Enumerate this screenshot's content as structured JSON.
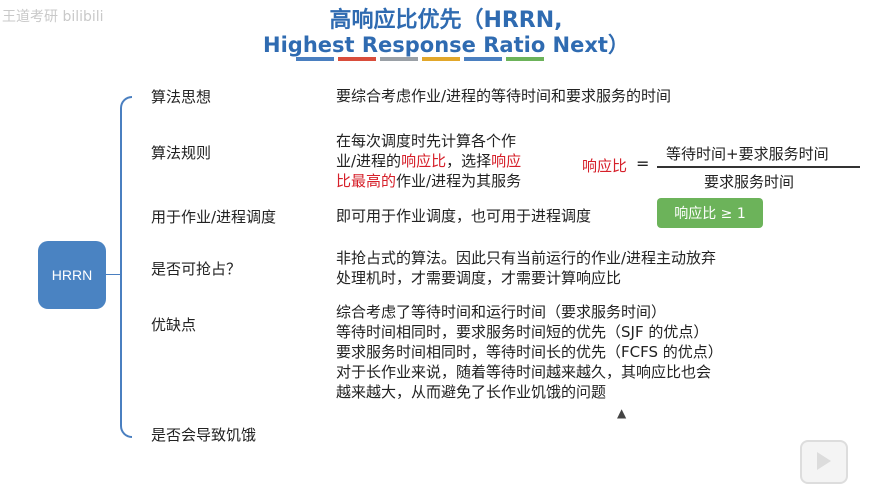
{
  "watermark": "王道考研 bilibili",
  "title": {
    "line1": "高响应比优先（HRRN,",
    "line2": "Highest Response Ratio Next）"
  },
  "stripe_colors": [
    "#4a7fc0",
    "#d94d3b",
    "#9aa0a6",
    "#e2a72a",
    "#4a7fc0",
    "#6cb35a"
  ],
  "center_node": "HRRN",
  "rows": [
    {
      "label": "算法思想",
      "content": "要综合考虑作业/进程的等待时间和要求服务的时间"
    },
    {
      "label": "算法规则",
      "content_parts": [
        "在每次调度时先计算各个作",
        "业/进程的",
        "响应比",
        "，选择",
        "响应",
        "比最高的",
        "作业/进程为其服务"
      ]
    },
    {
      "label": "用于作业/进程调度",
      "content": "即可用于作业调度，也可用于进程调度"
    },
    {
      "label": "是否可抢占？",
      "content_lines": [
        "非抢占式的算法。因此只有当前运行的作业/进程主动放弃",
        "处理机时，才需要调度，才需要计算响应比"
      ]
    },
    {
      "label": "优缺点",
      "content_lines": [
        "综合考虑了等待时间和运行时间（要求服务时间）",
        "等待时间相同时，要求服务时间短的优先（SJF 的优点）",
        "要求服务时间相同时，等待时间长的优先（FCFS 的优点）",
        "对于长作业来说，随着等待时间越来越久，其响应比也会",
        "越来越大，从而避免了长作业饥饿的问题"
      ]
    },
    {
      "label": "是否会导致饥饿",
      "content": ""
    }
  ],
  "formula": {
    "label": "响应比",
    "equals": "=",
    "numerator": "等待时间+要求服务时间",
    "denominator": "要求服务时间"
  },
  "badge": "响应比 ≥ 1",
  "icons": {
    "play": "play-icon",
    "cursor": "mouse-cursor-icon"
  }
}
